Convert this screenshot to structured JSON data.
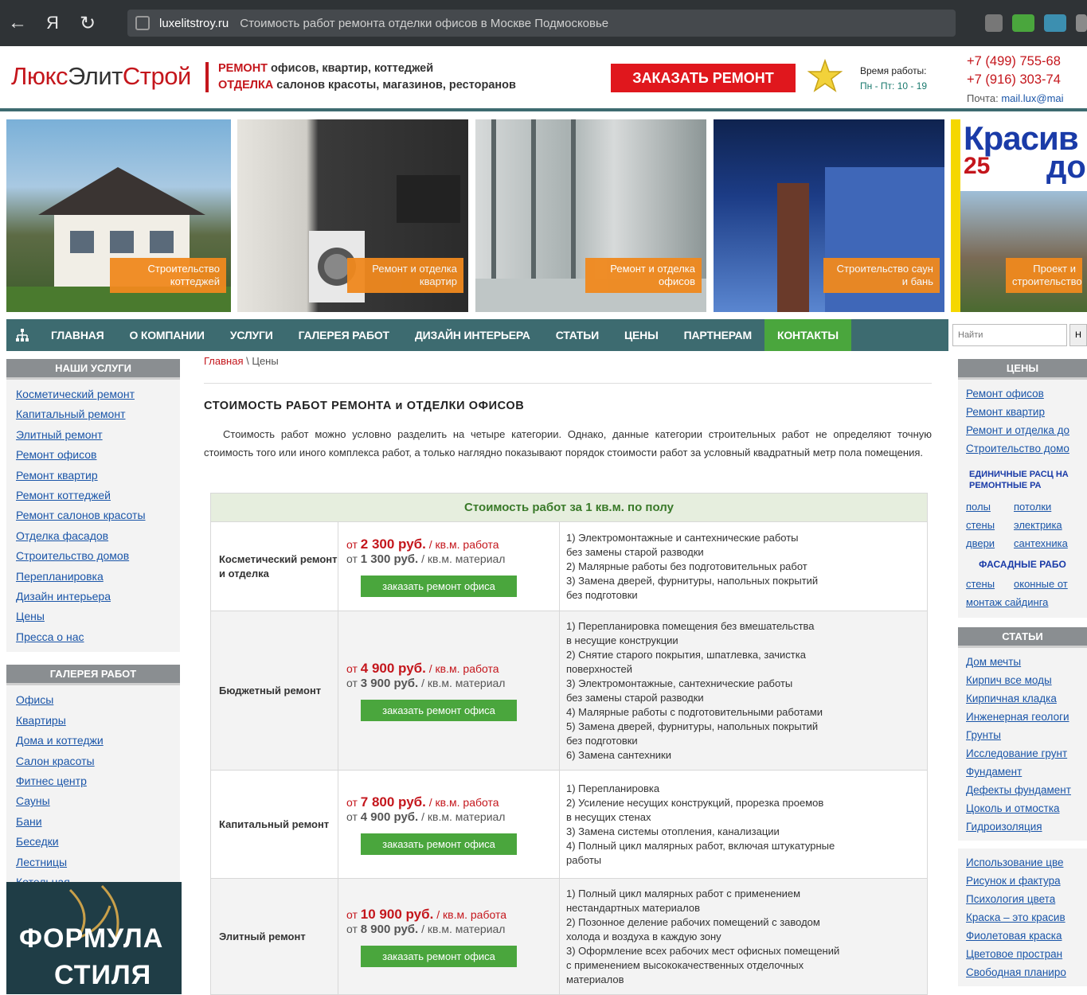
{
  "browser": {
    "domain": "luxelitstroy.ru",
    "title": "Стоимость работ ремонта отделки офисов в Москве Подмосковье"
  },
  "header": {
    "logo_part1": "Люкс",
    "logo_part2": "Элит",
    "logo_part3": "Строй",
    "tag_red1": "РЕМОНТ",
    "tag_line1": " офисов, квартир, коттеджей",
    "tag_red2": "ОТДЕЛКА",
    "tag_line2": " салонов красоты, магазинов, ресторанов",
    "order_button": "ЗАКАЗАТЬ РЕМОНТ",
    "hours_label": "Время работы:",
    "hours_value": "Пн - Пт: 10 - 19",
    "phone1": "+7 (499) 755-68",
    "phone2": "+7 (916) 303-74",
    "mail_label": "Почта: ",
    "mail_value": "mail.lux@mai"
  },
  "banners": [
    {
      "caption": "Строительство коттеджей",
      "colors": [
        "#7ab0d8",
        "#3b5b2a"
      ]
    },
    {
      "caption": "Ремонт и отделка квартир",
      "colors": [
        "#d8d6d0",
        "#3a3a3a"
      ]
    },
    {
      "caption": "Ремонт и отделка офисов",
      "colors": [
        "#c9cfcf",
        "#5a6466"
      ]
    },
    {
      "caption": "Строительство саун и бань",
      "colors": [
        "#1c3c86",
        "#5a86d0"
      ]
    },
    {
      "caption": "Проект и строительство",
      "title": "Красив",
      "badge": "25",
      "title2": "до",
      "colors": [
        "#f5d700",
        "#c4161c"
      ]
    }
  ],
  "nav": {
    "items": [
      {
        "label": "ГЛАВНАЯ"
      },
      {
        "label": "О КОМПАНИИ"
      },
      {
        "label": "УСЛУГИ"
      },
      {
        "label": "ГАЛЕРЕЯ РАБОТ"
      },
      {
        "label": "ДИЗАЙН ИНТЕРЬЕРА"
      },
      {
        "label": "СТАТЬИ"
      },
      {
        "label": "ЦЕНЫ"
      },
      {
        "label": "ПАРТНЕРАМ"
      },
      {
        "label": "КОНТАКТЫ"
      }
    ],
    "search_placeholder": "Найти",
    "search_button": "Н"
  },
  "left": {
    "services_title": "НАШИ УСЛУГИ",
    "services": [
      "Косметический ремонт",
      "Капитальный ремонт",
      "Элитный ремонт",
      "Ремонт офисов",
      "Ремонт квартир",
      "Ремонт коттеджей",
      "Ремонт салонов красоты",
      "Отделка фасадов",
      "Строительство домов",
      "Перепланировка",
      "Дизайн интерьера",
      "Цены",
      "Пресса о нас"
    ],
    "gallery_title": "ГАЛЕРЕЯ РАБОТ",
    "gallery": [
      "Офисы",
      "Квартиры",
      "Дома и коттеджи",
      "Салон красоты",
      "Фитнес центр",
      "Сауны",
      "Бани",
      "Беседки",
      "Лестницы",
      "Котельная"
    ],
    "promo_line1": "ФОРМУЛА",
    "promo_line2": "СТИЛЯ"
  },
  "main": {
    "breadcrumb_home": "Главная",
    "breadcrumb_sep": " \\ ",
    "breadcrumb_current": "Цены",
    "title": "СТОИМОСТЬ РАБОТ РЕМОНТА и ОТДЕЛКИ ОФИСОВ",
    "intro": "Стоимость работ можно условно разделить на четыре категории. Однако, данные категории строительных работ не определяют точную стоимость того или иного комплекса работ, а только наглядно показывают порядок стоимости работ за условный квадратный метр пола помещения.",
    "table_header": "Стоимость работ за 1 кв.м. по полу",
    "order_label": "заказать ремонт офиса",
    "rows": [
      {
        "category": "Косметический ремонт и отделка",
        "work_prefix": "от ",
        "work_price": "2 300 руб.",
        "work_unit": " / кв.м. работа",
        "mat_prefix": "от ",
        "mat_price": "1 300 руб.",
        "mat_unit": " / кв.м. материал",
        "desc": "1) Электромонтажные и сантехнические работы\nбез замены старой разводки\n2) Малярные работы без подготовительных работ\n3) Замена дверей, фурнитуры, напольных покрытий\nбез подготовки"
      },
      {
        "category": "Бюджетный ремонт",
        "work_prefix": "от ",
        "work_price": "4 900 руб.",
        "work_unit": " / кв.м. работа",
        "mat_prefix": "от ",
        "mat_price": "3 900 руб.",
        "mat_unit": " / кв.м. материал",
        "desc": "1) Перепланировка помещения без вмешательства\nв несущие конструкции\n2) Снятие старого покрытия, шпатлевка, зачистка\nповерхностей\n3) Электромонтажные, сантехнические работы\nбез замены старой разводки\n4) Малярные работы с подготовительными работами\n5) Замена дверей, фурнитуры, напольных покрытий\nбез подготовки\n6) Замена сантехники"
      },
      {
        "category": "Капитальный ремонт",
        "work_prefix": "от ",
        "work_price": "7 800 руб.",
        "work_unit": " / кв.м. работа",
        "mat_prefix": "от ",
        "mat_price": "4 900 руб.",
        "mat_unit": " / кв.м. материал",
        "desc": "1) Перепланировка\n2) Усиление несущих конструкций, прорезка проемов\nв несущих стенах\n3) Замена системы отопления, канализации\n4) Полный цикл малярных работ, включая штукатурные\nработы"
      },
      {
        "category": "Элитный ремонт",
        "work_prefix": "от ",
        "work_price": "10 900 руб.",
        "work_unit": " / кв.м. работа",
        "mat_prefix": "от ",
        "mat_price": "8 900 руб.",
        "mat_unit": " / кв.м. материал",
        "desc": "1) Полный цикл малярных работ с применением\nнестандартных материалов\n2) Позонное деление рабочих помещений с заводом\nхолода и воздуха в каждую зону\n3) Оформление всех рабочих мест офисных помещений\nс применением высококачественных отделочных\nматериалов"
      }
    ]
  },
  "right": {
    "prices_title": "ЦЕНЫ",
    "prices": [
      "Ремонт офисов",
      "Ремонт квартир",
      "Ремонт и отделка до",
      "Строительство домо"
    ],
    "unit_title": "ЕДИНИЧНЫЕ РАСЦ НА РЕМОНТНЫЕ РА",
    "unit_rows": [
      [
        "полы",
        "потолки"
      ],
      [
        "стены",
        "электрика"
      ],
      [
        "двери",
        "сантехника"
      ]
    ],
    "facade_title": "ФАСАДНЫЕ РАБО",
    "facade_rows": [
      [
        "стены",
        "оконные от"
      ]
    ],
    "facade_link": "монтаж сайдинга",
    "articles_title": "СТАТЬИ",
    "articles": [
      "Дом мечты",
      "Кирпич все моды",
      "Кирпичная кладка",
      "Инженерная геологи",
      "Грунты",
      "Исследование грунт",
      "Фундамент",
      "Дефекты фундамент",
      "Цоколь и отмостка",
      "Гидроизоляция"
    ],
    "articles2": [
      "Использование цве",
      "Рисунок и фактура",
      "Психология цвета",
      "Краска – это красив",
      "Фиолетовая краска",
      "Цветовое простран",
      "Свободная планиро"
    ]
  },
  "colors": {
    "accent_red": "#c4161c",
    "nav_teal": "#3d6b70",
    "green": "#4aa63d",
    "link_blue": "#1a55a8"
  }
}
